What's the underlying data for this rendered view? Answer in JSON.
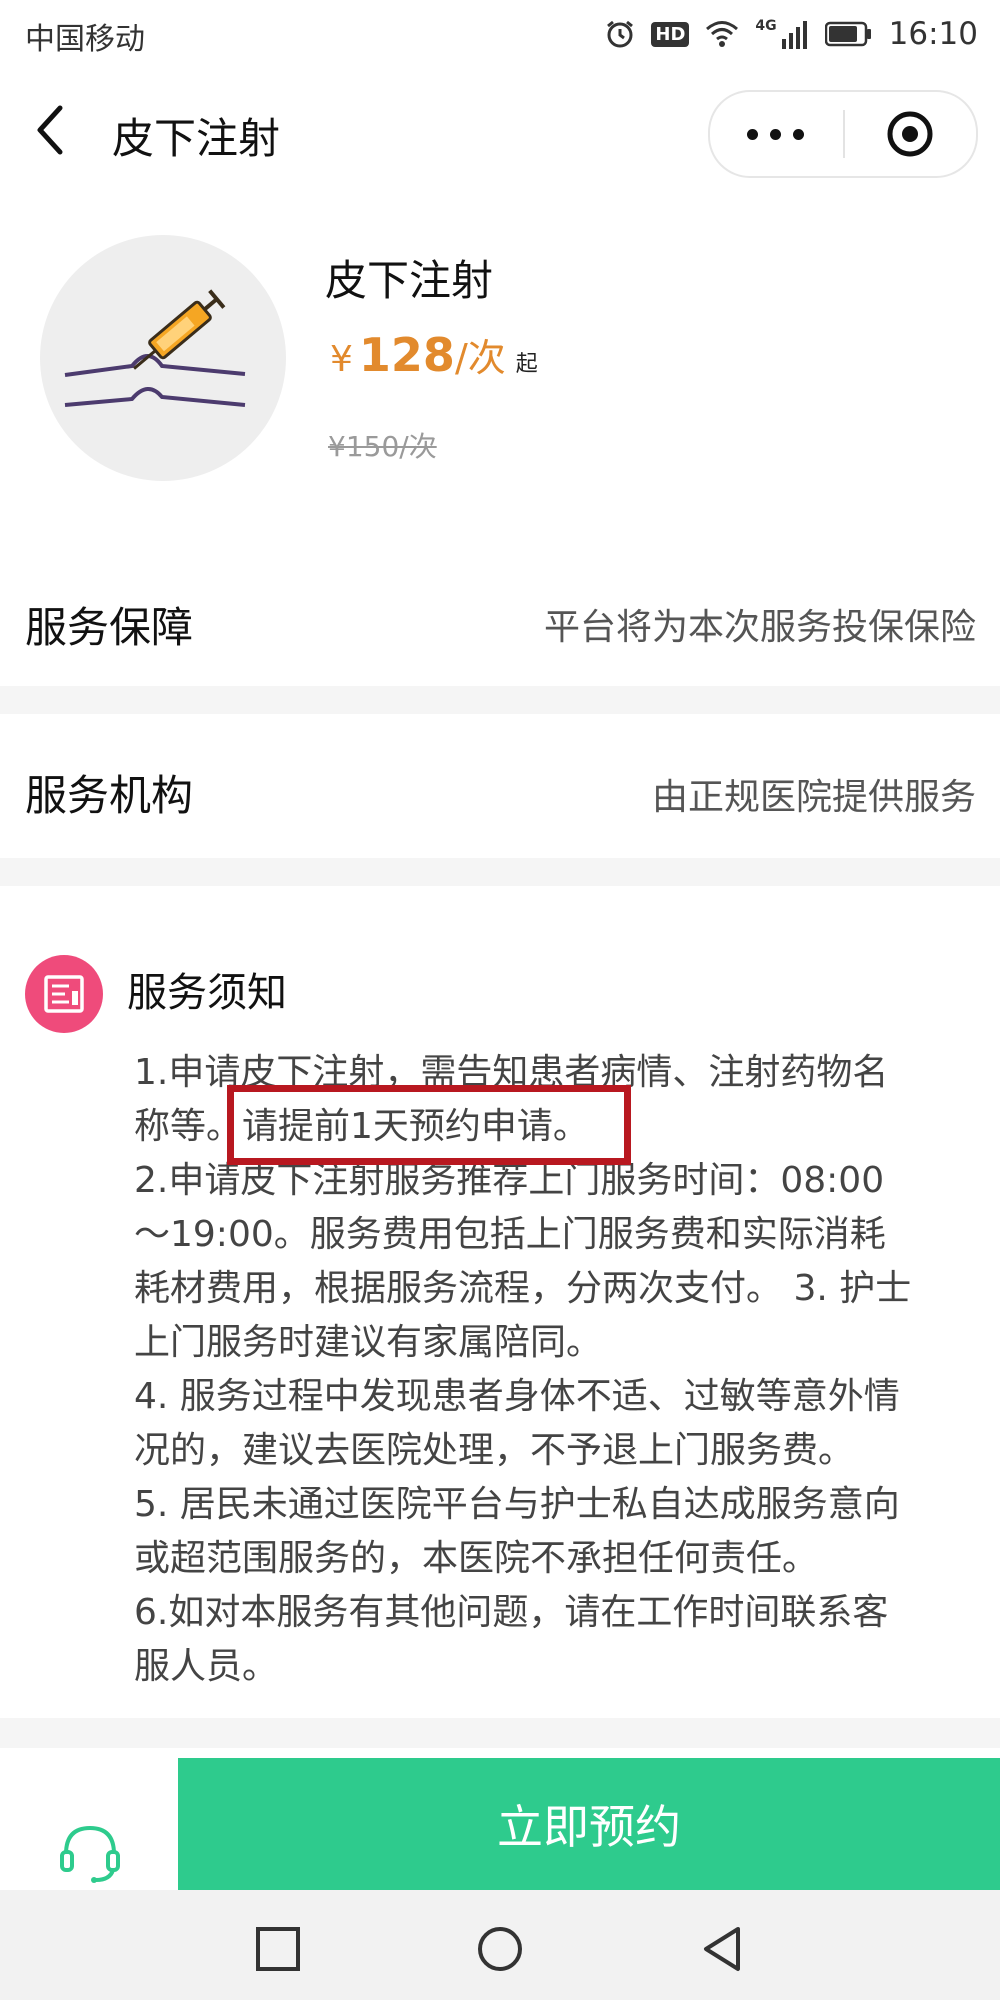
{
  "status_bar": {
    "carrier": "中国移动",
    "network": "4G",
    "hd": "HD",
    "time": "16:10"
  },
  "nav": {
    "title": "皮下注射",
    "more_icon": "more-dots-icon",
    "close_icon": "target-close-icon"
  },
  "product": {
    "name": "皮下注射",
    "price_currency": "¥",
    "price_amount": "128",
    "price_unit": "/次",
    "price_suffix": "起",
    "original_price": "¥150/次",
    "image_icon": "syringe-icon"
  },
  "rows": [
    {
      "label": "服务保障",
      "value": "平台将为本次服务投保保险"
    },
    {
      "label": "服务机构",
      "value": "由正规医院提供服务"
    }
  ],
  "notice": {
    "title": "服务须知",
    "icon": "document-icon",
    "lines": [
      "1.申请皮下注射，需告知患者病情、注射药物名",
      "称等。请提前1天预约申请。",
      "2.申请皮下注射服务推荐上门服务时间：08:00",
      "～19:00。服务费用包括上门服务费和实际消耗",
      "耗材费用，根据服务流程，分两次支付。 3. 护士",
      "上门服务时建议有家属陪同。",
      "4. 服务过程中发现患者身体不适、过敏等意外情",
      "况的，建议去医院处理，不予退上门服务费。",
      "5. 居民未通过医院平台与护士私自达成服务意向",
      "或超范围服务的，本医院不承担任何责任。",
      "6.如对本服务有其他问题，请在工作时间联系客",
      "服人员。"
    ]
  },
  "bottom": {
    "service_icon": "headset-icon",
    "book_label": "立即预约"
  },
  "colors": {
    "price": "#e28a2d",
    "accent_green": "#2ecb8d",
    "notice_icon_bg": "#ef4b7b",
    "highlight_border": "#b81820"
  }
}
